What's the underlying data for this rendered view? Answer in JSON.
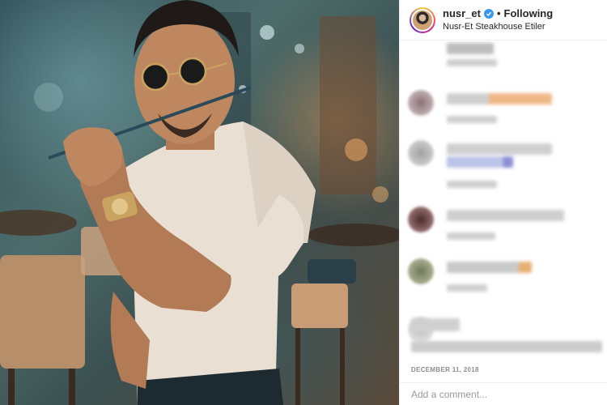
{
  "post": {
    "username": "nusr_et",
    "follow_status": "Following",
    "separator": "•",
    "location": "Nusr-Et Steakhouse Etiler",
    "date": "DECEMBER 11, 2018",
    "comment_placeholder": "Add a comment..."
  },
  "icons": {
    "verified": "verified-badge-icon",
    "avatar": "profile-avatar"
  },
  "colors": {
    "verified_blue": "#3897f0",
    "text_primary": "#262626",
    "text_secondary": "#8e8e8e",
    "divider": "#efefef"
  }
}
